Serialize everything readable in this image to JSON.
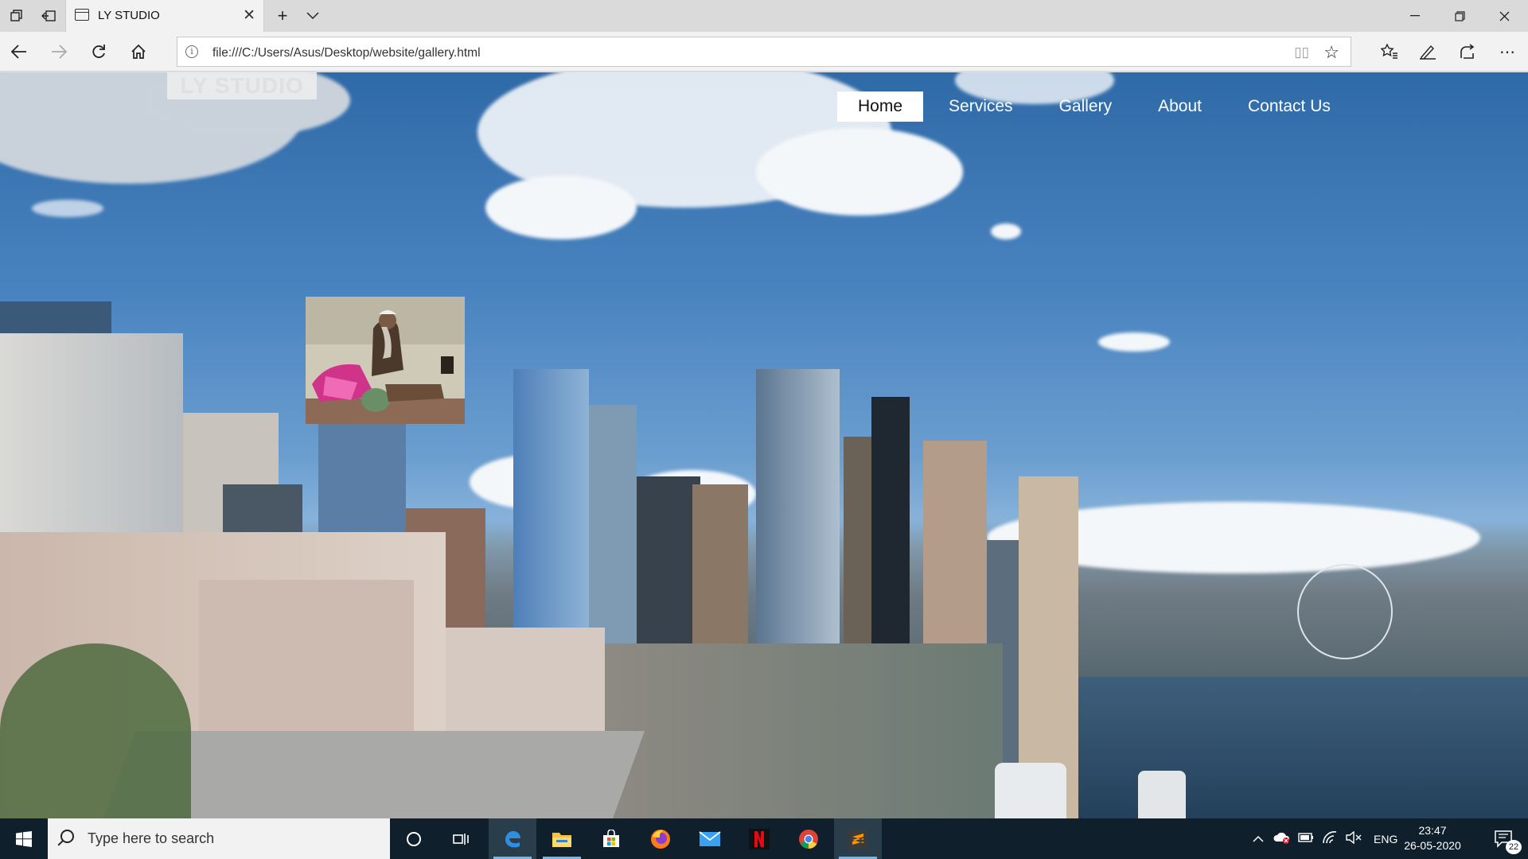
{
  "browser": {
    "tab": {
      "title": "LY STUDIO"
    },
    "address": {
      "url": "file:///C:/Users/Asus/Desktop/website/gallery.html"
    }
  },
  "site": {
    "logo": "LY STUDIO",
    "nav": [
      {
        "label": "Home",
        "active": true
      },
      {
        "label": "Services",
        "active": false
      },
      {
        "label": "Gallery",
        "active": false
      },
      {
        "label": "About",
        "active": false
      },
      {
        "label": "Contact Us",
        "active": false
      }
    ]
  },
  "taskbar": {
    "search_placeholder": "Type here to search",
    "apps": [
      "task-view",
      "edge",
      "file-explorer",
      "store",
      "firefox",
      "mail",
      "netflix",
      "chrome",
      "sublime-text"
    ],
    "tray": {
      "language": "ENG",
      "time": "23:47",
      "date": "26-05-2020",
      "notifications": "22"
    }
  },
  "colors": {
    "taskbar": "#0f1f2b",
    "nav_active_bg": "#ffffff",
    "sky": "#4a84c0"
  }
}
